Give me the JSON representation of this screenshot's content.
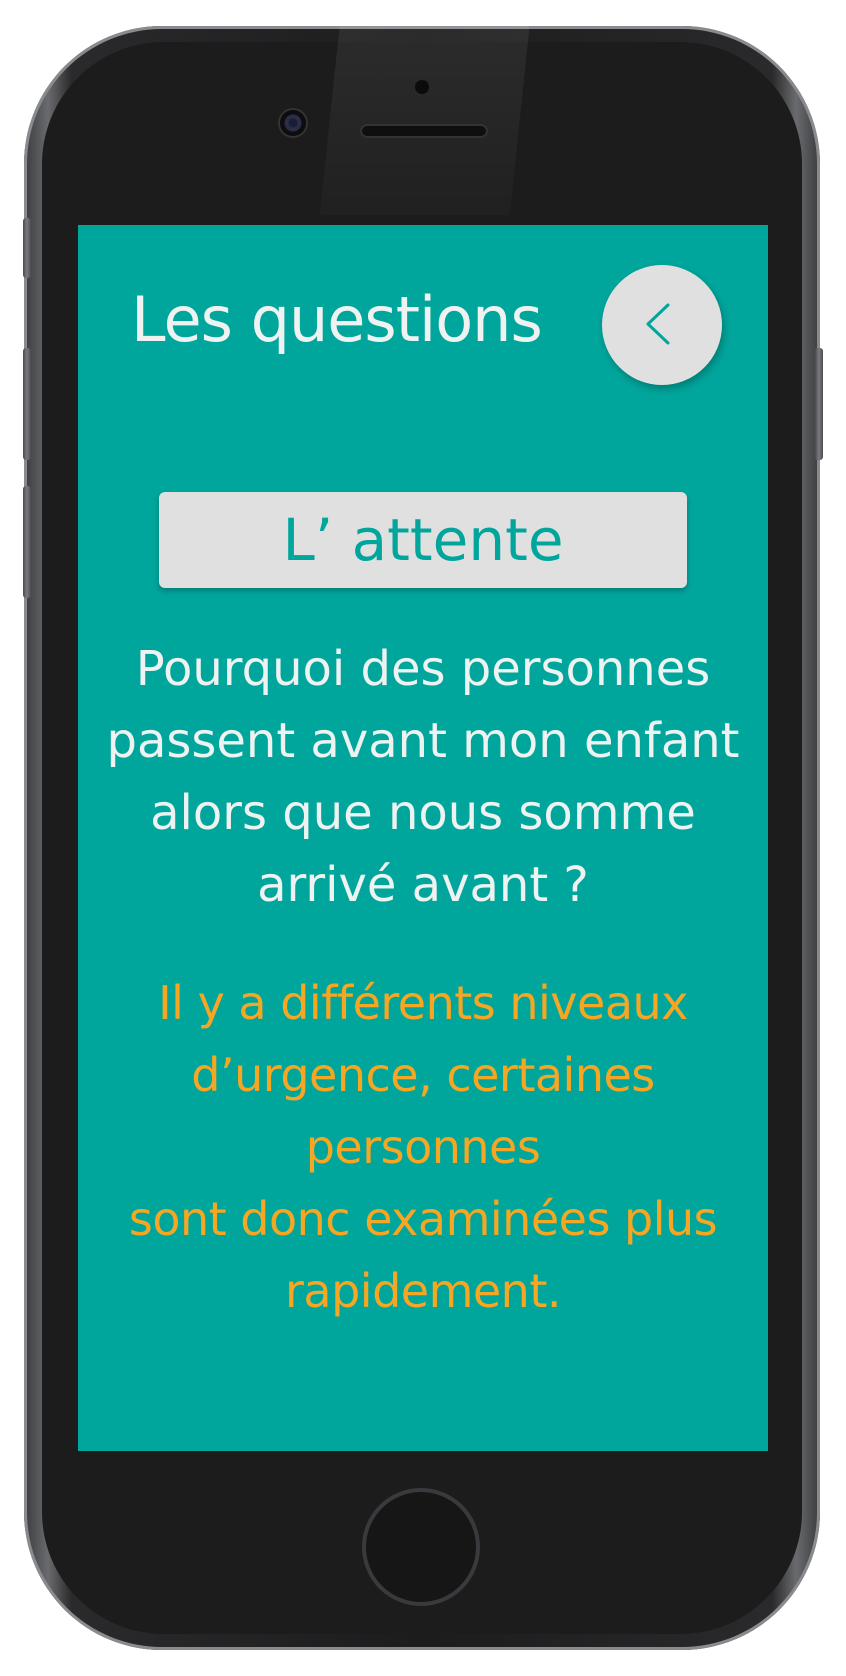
{
  "header": {
    "title": "Les questions"
  },
  "topic": {
    "label": "L’ attente"
  },
  "question": {
    "line1": "Pourquoi des personnes",
    "line2": "passent avant mon enfant",
    "line3": "alors que nous somme",
    "line4": "arrivé avant ?"
  },
  "answer": {
    "line1": "Il y a différents niveaux",
    "line2": "d’urgence, certaines personnes",
    "line3": "sont donc examinées plus",
    "line4": "rapidement."
  },
  "icons": {
    "back": "chevron-left-icon"
  },
  "colors": {
    "background": "#00a69c",
    "title_text": "#eef2f1",
    "card": "#e0e0e0",
    "accent": "#00a69c",
    "answer_text": "#f5a623"
  }
}
